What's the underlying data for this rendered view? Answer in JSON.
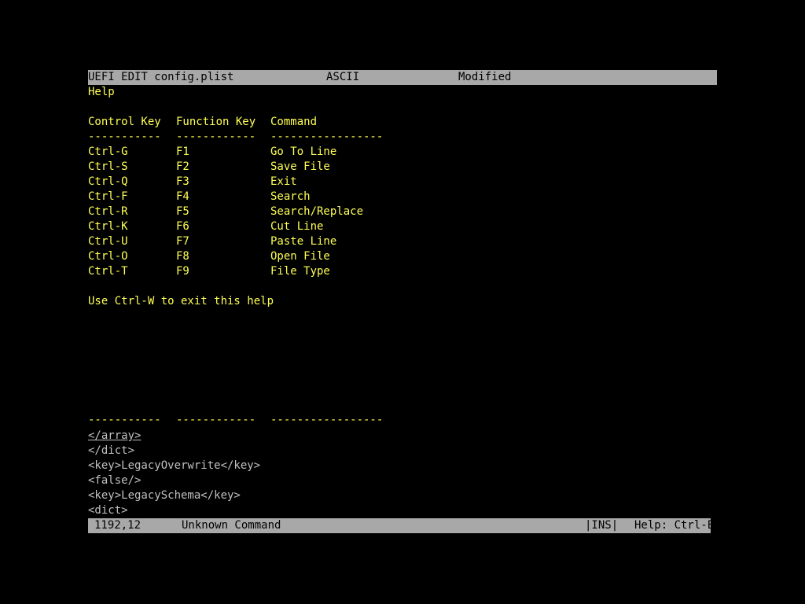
{
  "title_bar": {
    "app": "UEFI EDIT config.plist",
    "encoding": "ASCII",
    "status": "Modified"
  },
  "help": {
    "heading": "Help",
    "columns": [
      "Control Key",
      "Function Key",
      "Command"
    ],
    "separators": [
      "-----------",
      "------------",
      "-----------------"
    ],
    "rows": [
      {
        "ctrl": "Ctrl-G",
        "fn": "F1",
        "cmd": "Go To Line"
      },
      {
        "ctrl": "Ctrl-S",
        "fn": "F2",
        "cmd": "Save File"
      },
      {
        "ctrl": "Ctrl-Q",
        "fn": "F3",
        "cmd": "Exit"
      },
      {
        "ctrl": "Ctrl-F",
        "fn": "F4",
        "cmd": "Search"
      },
      {
        "ctrl": "Ctrl-R",
        "fn": "F5",
        "cmd": "Search/Replace"
      },
      {
        "ctrl": "Ctrl-K",
        "fn": "F6",
        "cmd": "Cut Line"
      },
      {
        "ctrl": "Ctrl-U",
        "fn": "F7",
        "cmd": "Paste Line"
      },
      {
        "ctrl": "Ctrl-O",
        "fn": "F8",
        "cmd": "Open File"
      },
      {
        "ctrl": "Ctrl-T",
        "fn": "F9",
        "cmd": "File Type"
      }
    ],
    "exit_hint": "Use Ctrl-W to exit this help"
  },
  "editor": {
    "lines": [
      "</array>",
      "</dict>",
      "<key>LegacyOverwrite</key>",
      "<false/>",
      "<key>LegacySchema</key>",
      "<dict>"
    ]
  },
  "status_bar": {
    "position": "1192,12",
    "message": "Unknown Command",
    "mode": "|INS|",
    "help": "Help: Ctrl-E"
  },
  "colors": {
    "background": "#000000",
    "bar": "#a8a8a8",
    "help_text": "#ffff55",
    "editor_text": "#c0c0c0"
  }
}
